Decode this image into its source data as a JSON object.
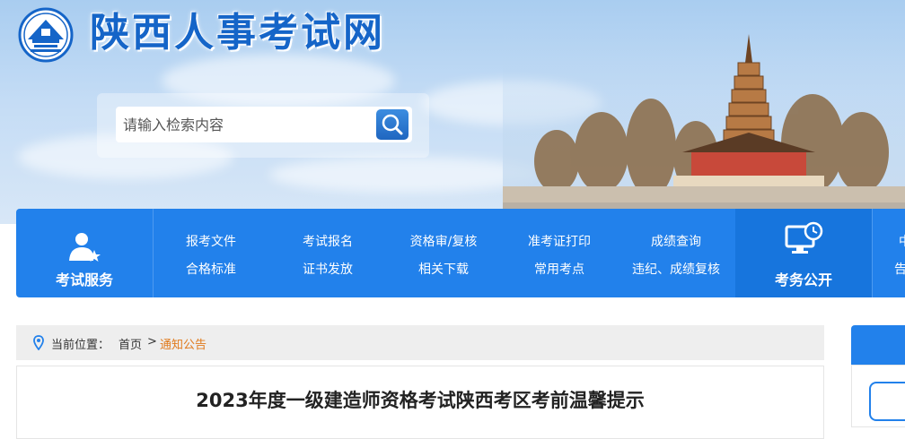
{
  "site": {
    "title": "陕西人事考试网"
  },
  "search": {
    "placeholder": "请输入检索内容"
  },
  "nav": {
    "service_label": "考试服务",
    "links": [
      {
        "top": "报考文件",
        "bottom": "合格标准"
      },
      {
        "top": "考试报名",
        "bottom": "证书发放"
      },
      {
        "top": "资格审/复核",
        "bottom": "相关下载"
      },
      {
        "top": "准考证打印",
        "bottom": "常用考点"
      },
      {
        "top": "成绩查询",
        "bottom": "违纪、成绩复核"
      }
    ],
    "public_label": "考务公开",
    "extra_top": "中",
    "extra_bottom": "告"
  },
  "breadcrumb": {
    "prefix": "当前位置：",
    "home": "首页",
    "separator": ">",
    "current": "通知公告"
  },
  "article": {
    "title": "2023年度一级建造师资格考试陕西考区考前温馨提示"
  },
  "colors": {
    "brand_blue": "#2281eb",
    "title_blue": "#1565c8",
    "breadcrumb_current": "#e07a1c"
  }
}
